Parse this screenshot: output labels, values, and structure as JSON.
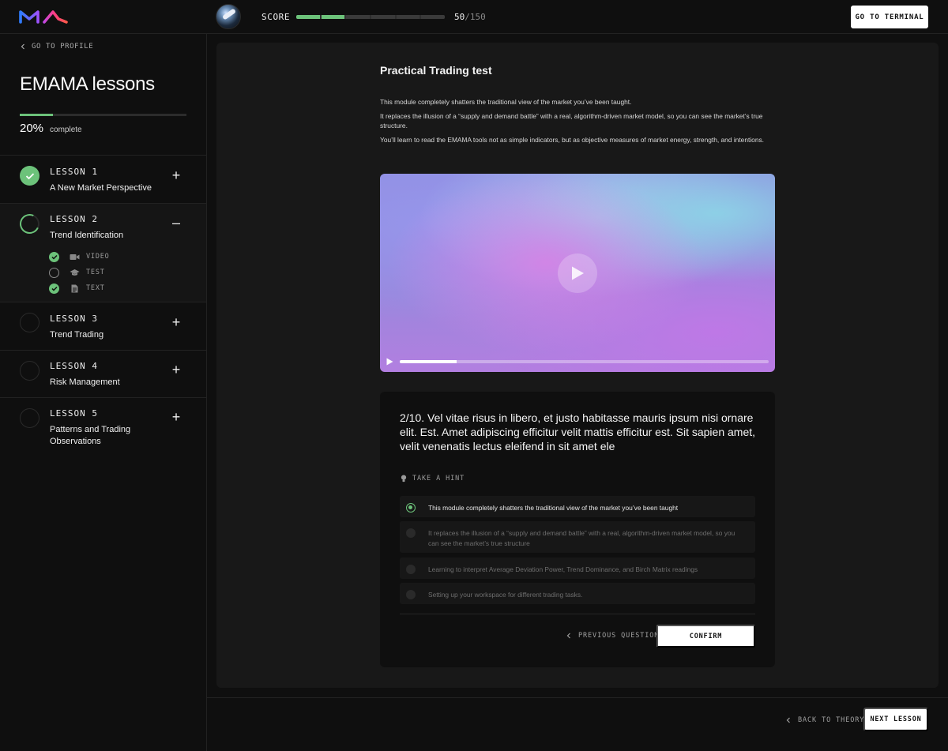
{
  "header": {
    "score_label": "SCORE",
    "score_value": "50",
    "score_total": "/150",
    "score_fraction": 0.333,
    "terminal_button": "GO TO TERMINAL"
  },
  "sidebar": {
    "back_label": "GO TO PROFILE",
    "course_title": "EMAMA lessons",
    "progress_pct": "20%",
    "progress_fraction": 0.2,
    "progress_label": "complete",
    "lessons": [
      {
        "number": "LESSON 1",
        "name": "A New Market Perspective",
        "status": "done",
        "toggle": "+"
      },
      {
        "number": "LESSON 2",
        "name": "Trend Identification",
        "status": "in-progress",
        "toggle": "–",
        "items": [
          {
            "label": "VIDEO",
            "done": true,
            "icon": "video-camera-icon"
          },
          {
            "label": "TEST",
            "done": false,
            "icon": "graduation-cap-icon"
          },
          {
            "label": "TEXT",
            "done": true,
            "icon": "document-icon"
          }
        ]
      },
      {
        "number": "LESSON 3",
        "name": "Trend Trading",
        "status": "not-started",
        "toggle": "+"
      },
      {
        "number": "LESSON 4",
        "name": "Risk Management",
        "status": "not-started",
        "toggle": "+"
      },
      {
        "number": "LESSON 5",
        "name": "Patterns and Trading Observations",
        "status": "not-started",
        "toggle": "+"
      }
    ]
  },
  "main": {
    "title": "Practical Trading test",
    "description": [
      "This module completely shatters the traditional view of the market you’ve been taught.",
      "It replaces the illusion of a “supply and demand battle” with a real, algorithm-driven market model, so you can see the market’s true structure.",
      "You’ll learn to read the EMAMA tools not as simple indicators, but as objective measures of market energy, strength, and intentions."
    ],
    "video": {
      "progress_fraction": 0.155
    }
  },
  "quiz": {
    "question": "2/10. Vel vitae risus in libero, et justo habitasse mauris ipsum nisi ornare elit. Est. Amet adipiscing efficitur velit mattis efficitur est. Sit sapien amet, velit venenatis lectus eleifend in sit amet ele",
    "hint_label": "TAKE A HINT",
    "options": [
      {
        "text": "This module completely shatters the traditional view of the market you’ve been taught",
        "selected": true
      },
      {
        "text": "It replaces the illusion of a “supply and demand battle” with a real, algorithm-driven market model, so you can see the market’s true structure",
        "selected": false
      },
      {
        "text": "Learning to interpret Average Deviation Power, Trend Dominance, and Birch Matrix readings",
        "selected": false
      },
      {
        "text": "Setting up your workspace for different trading tasks.",
        "selected": false
      }
    ],
    "prev_label": "PREVIOUS QUESTION",
    "confirm_label": "CONFIRM"
  },
  "footer": {
    "back_label": "BACK TO THEORY",
    "next_label": "NEXT LESSON"
  },
  "colors": {
    "accent": "#6cc27a",
    "background": "#0f0f0f",
    "panel": "#181818"
  }
}
